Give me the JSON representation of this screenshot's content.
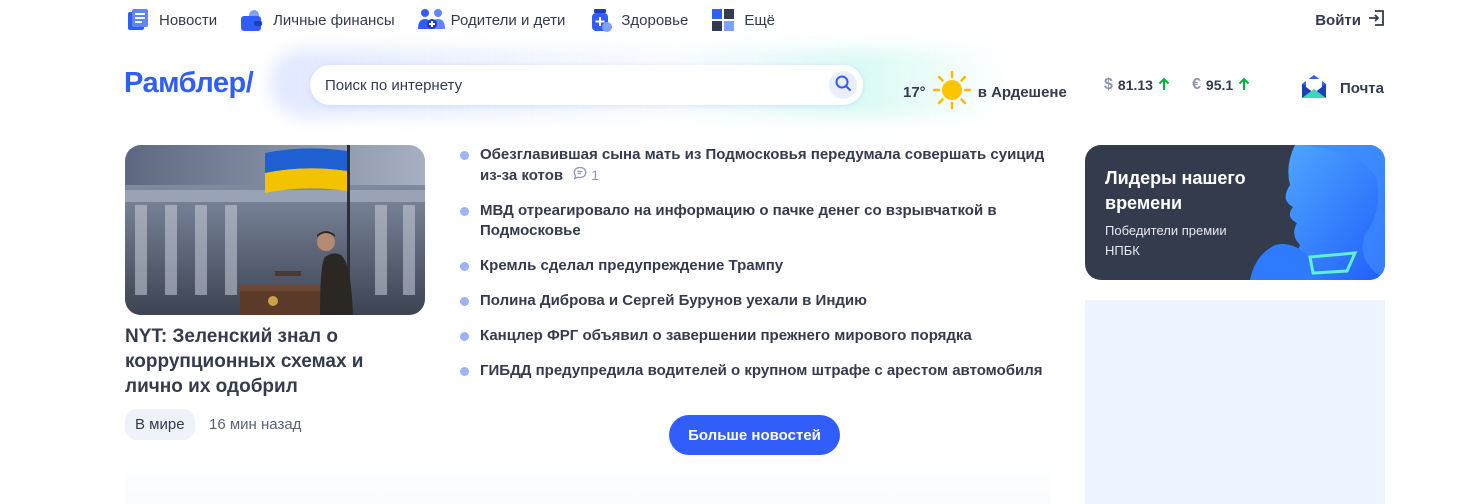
{
  "topnav": {
    "items": [
      {
        "label": "Новости",
        "icon": "newspaper-icon"
      },
      {
        "label": "Личные финансы",
        "icon": "wallet-icon"
      },
      {
        "label": "Родители и дети",
        "icon": "family-icon"
      },
      {
        "label": "Здоровье",
        "icon": "medicine-icon"
      },
      {
        "label": "Ещё",
        "icon": "grid-icon"
      }
    ],
    "login_label": "Войти"
  },
  "header": {
    "logo": "Рамблер/",
    "search_placeholder": "Поиск по интернету",
    "weather": {
      "temp": "17°",
      "city": "в Ардешене",
      "icon": "sun-icon"
    },
    "currencies": [
      {
        "symbol": "$",
        "value": "81.13",
        "trend": "up"
      },
      {
        "symbol": "€",
        "value": "95.1",
        "trend": "up"
      }
    ],
    "mail_label": "Почта"
  },
  "main_story": {
    "title": "NYT: Зеленский знал о коррупционных схемах и лично их одобрил",
    "tag": "В мире",
    "time": "16 мин назад"
  },
  "news": [
    {
      "title": "Обезглавившая сына мать из Подмосковья передумала совершать суицид из-за котов",
      "comments": "1"
    },
    {
      "title": "МВД отреагировало на информацию о пачке денег со взрывчаткой в Подмосковье"
    },
    {
      "title": "Кремль сделал предупреждение Трампу"
    },
    {
      "title": "Полина Диброва и Сергей Бурунов уехали в Индию"
    },
    {
      "title": "Канцлер ФРГ объявил о завершении прежнего мирового порядка"
    },
    {
      "title": "ГИБДД предупредила водителей о крупном штрафе с арестом автомобиля"
    }
  ],
  "more_button": "Больше новостей",
  "promo": {
    "title": "Лидеры нашего времени",
    "subtitle": "Победители премии НПБК"
  },
  "colors": {
    "accent": "#315efb",
    "text": "#343b4c",
    "trend_up": "#00b53c"
  }
}
